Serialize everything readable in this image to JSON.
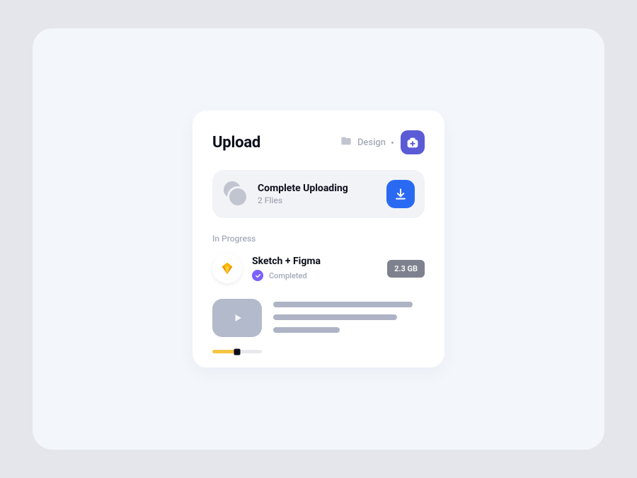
{
  "header": {
    "title": "Upload",
    "breadcrumb_label": "Design"
  },
  "complete": {
    "title": "Complete Uploading",
    "subtitle": "2 Flies"
  },
  "section_label": "In Progress",
  "file": {
    "name": "Sketch + Figma",
    "status": "Completed",
    "size": "2.3 GB"
  }
}
